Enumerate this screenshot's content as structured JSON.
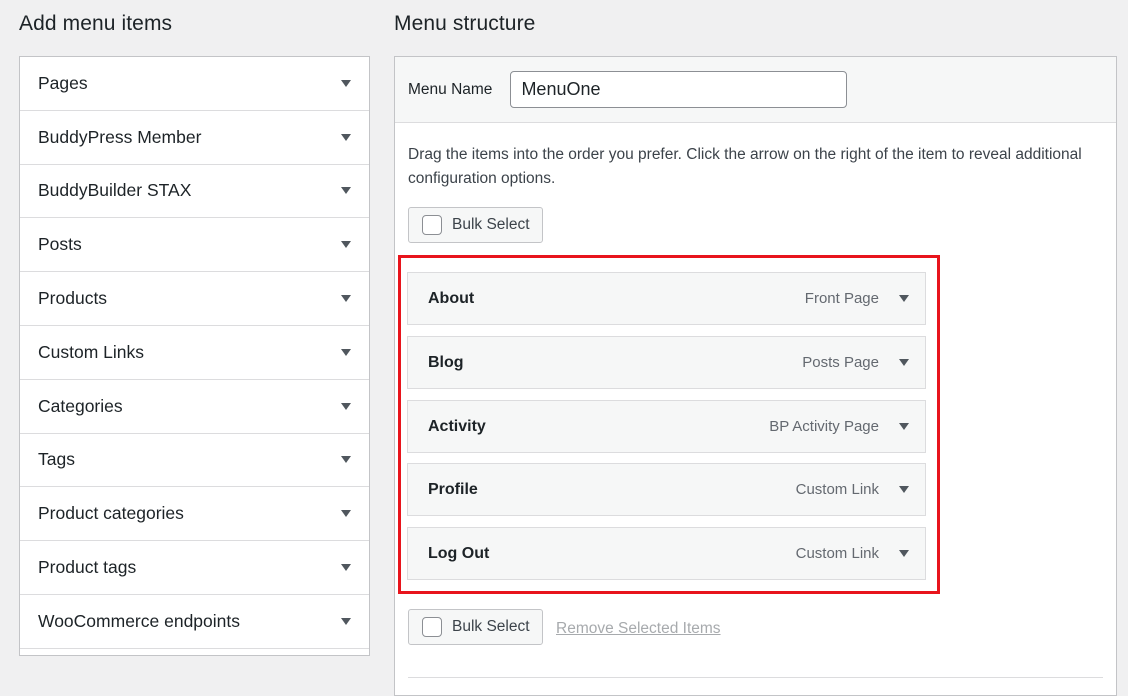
{
  "left": {
    "title": "Add menu items",
    "items": [
      {
        "label": "Pages"
      },
      {
        "label": "BuddyPress Member"
      },
      {
        "label": "BuddyBuilder STAX"
      },
      {
        "label": "Posts"
      },
      {
        "label": "Products"
      },
      {
        "label": "Custom Links"
      },
      {
        "label": "Categories"
      },
      {
        "label": "Tags"
      },
      {
        "label": "Product categories"
      },
      {
        "label": "Product tags"
      },
      {
        "label": "WooCommerce endpoints"
      }
    ]
  },
  "right": {
    "title": "Menu structure",
    "menu_name_label": "Menu Name",
    "menu_name_value": "MenuOne",
    "instructions": "Drag the items into the order you prefer. Click the arrow on the right of the item to reveal additional configuration options.",
    "bulk_select_label": "Bulk Select",
    "remove_selected_label": "Remove Selected Items",
    "menu_items": [
      {
        "title": "About",
        "type": "Front Page"
      },
      {
        "title": "Blog",
        "type": "Posts Page"
      },
      {
        "title": "Activity",
        "type": "BP Activity Page"
      },
      {
        "title": "Profile",
        "type": "Custom Link"
      },
      {
        "title": "Log Out",
        "type": "Custom Link"
      }
    ]
  },
  "colors": {
    "highlight": "#e8141c",
    "background": "#f0f0f1"
  }
}
